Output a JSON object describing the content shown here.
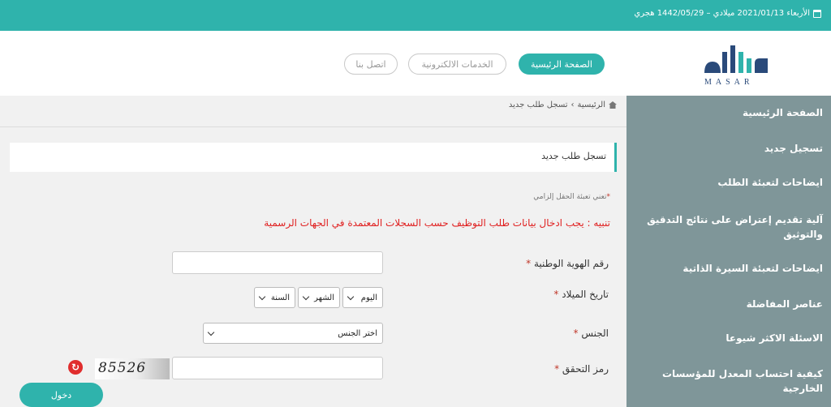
{
  "topbar": {
    "date_text": "الأربعاء 2021/01/13 ميلادي – 1442/05/29 هجري"
  },
  "logo": {
    "subtitle": "MASAR"
  },
  "nav": {
    "home": "الصفحة الرئيسية",
    "services": "الخدمات الالكترونية",
    "contact": "اتصل بنا"
  },
  "sidebar": {
    "items": [
      {
        "label": "الصفحة الرئيسية"
      },
      {
        "label": "تسجيل جديد"
      },
      {
        "label": "ايضاحات لتعبئة الطلب"
      },
      {
        "label": "آلية تقديم إعتراض على نتائج التدقيق والتوثيق"
      },
      {
        "label": "ايضاحات لتعبئة السيرة الذاتية"
      },
      {
        "label": "عناصر المفاضلة"
      },
      {
        "label": "الاسئلة الاكثر شيوعا"
      },
      {
        "label": "كيفية احتساب المعدل للمؤسسات الخارجية"
      }
    ]
  },
  "breadcrumb": {
    "home": "الرئيسية",
    "separator": "›",
    "current": "تسجل طلب جديد"
  },
  "panel": {
    "title": "تسجل طلب جديد"
  },
  "form": {
    "required_note": "تعني تعبئة الحقل إلزامي",
    "warning": "تنبيه : يجب ادخال بيانات طلب التوظيف حسب السجلات المعتمدة في الجهات الرسمية",
    "national_id_label": "رقم الهوية الوطنية",
    "dob_label": "تاريخ الميلاد",
    "day": "اليوم",
    "month": "الشهر",
    "year": "السنة",
    "gender_label": "الجنس",
    "gender_placeholder": "اختر الجنس",
    "captcha_label": "رمز التحقق",
    "captcha_code": "85526",
    "login_button": "دخول",
    "required_star": "*"
  }
}
